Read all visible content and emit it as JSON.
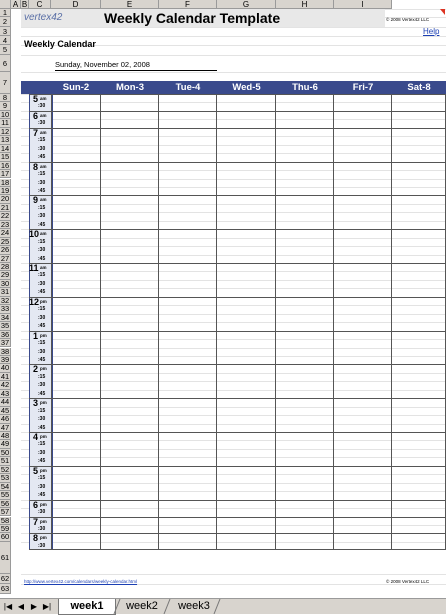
{
  "columns": [
    "A",
    "B",
    "C",
    "D",
    "E",
    "F",
    "G",
    "H",
    "I"
  ],
  "rows": [
    "1",
    "2",
    "3",
    "4",
    "5",
    "6",
    "7",
    "8",
    "9",
    "10",
    "11",
    "12",
    "13",
    "14",
    "15",
    "16",
    "17",
    "18",
    "19",
    "20",
    "21",
    "22",
    "23",
    "24",
    "25",
    "26",
    "27",
    "28",
    "29",
    "30",
    "31",
    "32",
    "33",
    "34",
    "35",
    "36",
    "37",
    "38",
    "39",
    "40",
    "41",
    "42",
    "43",
    "44",
    "45",
    "46",
    "47",
    "48",
    "49",
    "50",
    "51",
    "52",
    "53",
    "54",
    "55",
    "56",
    "57",
    "58",
    "59",
    "60",
    "61",
    "62",
    "63"
  ],
  "header": {
    "logo": "vertex42",
    "title": "Weekly Calendar Template",
    "copyright": "© 2008 Vertex42 LLC",
    "help": "Help"
  },
  "calendar": {
    "subtitle": "Weekly Calendar",
    "start_date": "Sunday, November 02, 2008",
    "days": [
      "Sun-2",
      "Mon-3",
      "Tue-4",
      "Wed-5",
      "Thu-6",
      "Fri-7",
      "Sat-8"
    ],
    "hours": [
      {
        "hour": "5",
        "ampm": "am",
        "mins": [
          ":30"
        ]
      },
      {
        "hour": "6",
        "ampm": "am",
        "mins": [
          ":30"
        ]
      },
      {
        "hour": "7",
        "ampm": "am",
        "mins": [
          ":15",
          ":30",
          ":45"
        ]
      },
      {
        "hour": "8",
        "ampm": "am",
        "mins": [
          ":15",
          ":30",
          ":45"
        ]
      },
      {
        "hour": "9",
        "ampm": "am",
        "mins": [
          ":15",
          ":30",
          ":45"
        ]
      },
      {
        "hour": "10",
        "ampm": "am",
        "mins": [
          ":15",
          ":30",
          ":45"
        ]
      },
      {
        "hour": "11",
        "ampm": "am",
        "mins": [
          ":15",
          ":30",
          ":45"
        ]
      },
      {
        "hour": "12",
        "ampm": "pm",
        "mins": [
          ":15",
          ":30",
          ":45"
        ]
      },
      {
        "hour": "1",
        "ampm": "pm",
        "mins": [
          ":15",
          ":30",
          ":45"
        ]
      },
      {
        "hour": "2",
        "ampm": "pm",
        "mins": [
          ":15",
          ":30",
          ":45"
        ]
      },
      {
        "hour": "3",
        "ampm": "pm",
        "mins": [
          ":15",
          ":30",
          ":45"
        ]
      },
      {
        "hour": "4",
        "ampm": "pm",
        "mins": [
          ":15",
          ":30",
          ":45"
        ]
      },
      {
        "hour": "5",
        "ampm": "pm",
        "mins": [
          ":15",
          ":30",
          ":45"
        ]
      },
      {
        "hour": "6",
        "ampm": "pm",
        "mins": [
          ":30"
        ]
      },
      {
        "hour": "7",
        "ampm": "pm",
        "mins": [
          ":30"
        ]
      },
      {
        "hour": "8",
        "ampm": "pm",
        "mins": [
          ":30"
        ]
      }
    ]
  },
  "footer": {
    "url": "http://www.vertex42.com/calendars/weekly-calendar.html",
    "copyright": "© 2008 Vertex42 LLC"
  },
  "tabs": [
    "week1",
    "week2",
    "week3"
  ],
  "active_tab": "week1",
  "colors": {
    "header_blue": "#3a4a8c",
    "time_col": "#e4e8f2",
    "grid": "#d8d4ce"
  }
}
